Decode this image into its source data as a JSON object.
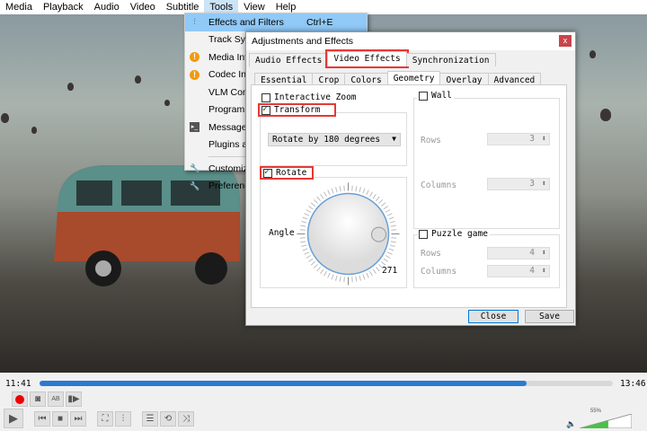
{
  "menu": [
    "Media",
    "Playback",
    "Audio",
    "Video",
    "Subtitle",
    "Tools",
    "View",
    "Help"
  ],
  "tools_menu": [
    {
      "label": "Effects and Filters",
      "shortcut": "Ctrl+E",
      "icon": "equalizer-icon"
    },
    {
      "label": "Track Sync",
      "icon": ""
    },
    {
      "label": "Media Info",
      "icon": "info-icon"
    },
    {
      "label": "Codec Info",
      "icon": "info-icon"
    },
    {
      "label": "VLM Conf",
      "icon": ""
    },
    {
      "label": "Program G",
      "icon": ""
    },
    {
      "label": "Messages",
      "icon": "messages-icon"
    },
    {
      "label": "Plugins an",
      "icon": ""
    },
    {
      "label": "Customize",
      "icon": "wrench-icon"
    },
    {
      "label": "Preferences",
      "icon": "wrench-icon"
    }
  ],
  "dialog": {
    "title": "Adjustments and Effects",
    "close": "x",
    "tabs": [
      "Audio Effects",
      "Video Effects",
      "Synchronization"
    ],
    "subtabs": [
      "Essential",
      "Crop",
      "Colors",
      "Geometry",
      "Overlay",
      "Advanced"
    ],
    "interactive_zoom": "Interactive Zoom",
    "transform": "Transform",
    "transform_option": "Rotate by 180 degrees",
    "rotate": "Rotate",
    "angle_label": "Angle",
    "angle_value": "271",
    "wall": "Wall",
    "wall_rows_label": "Rows",
    "wall_rows": "3",
    "wall_cols_label": "Columns",
    "wall_cols": "3",
    "puzzle": "Puzzle game",
    "puzzle_rows_label": "Rows",
    "puzzle_rows": "4",
    "puzzle_cols_label": "Columns",
    "puzzle_cols": "4",
    "close_btn": "Close",
    "save_btn": "Save"
  },
  "player": {
    "elapsed": "11:41",
    "total": "13:46",
    "progress_percent": 85,
    "volume": "55%",
    "volume_percent": 55
  }
}
